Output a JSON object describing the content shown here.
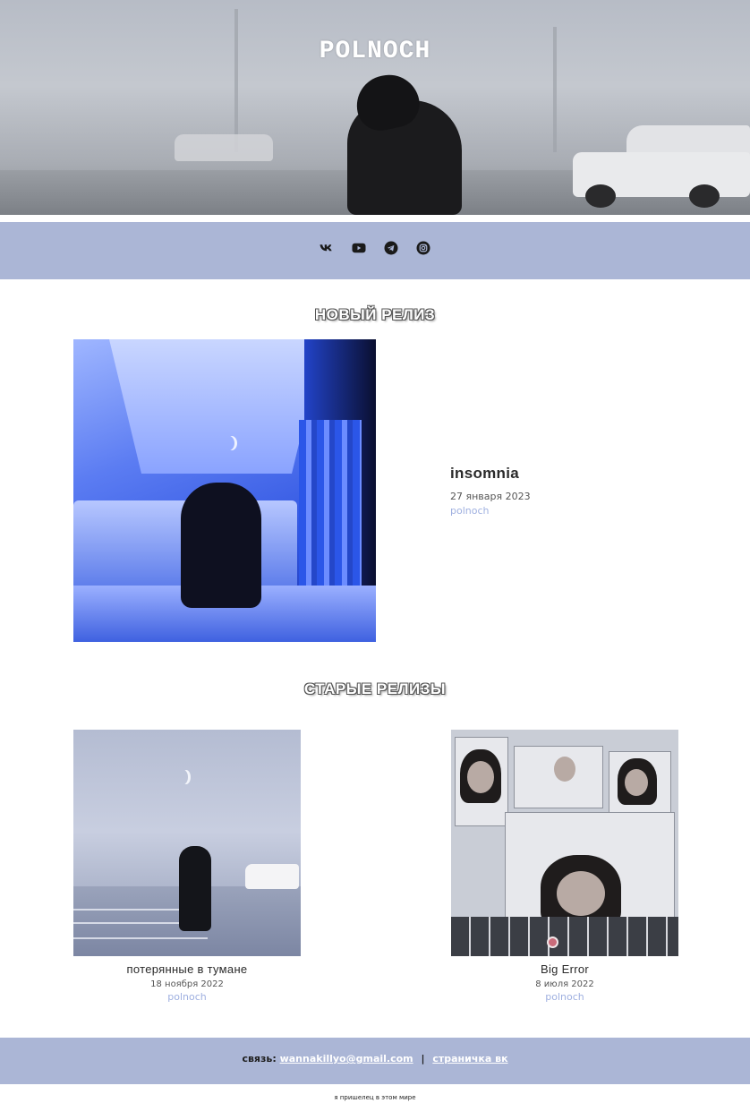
{
  "hero": {
    "title": "POLNOCH"
  },
  "social": [
    {
      "name": "vk-icon"
    },
    {
      "name": "youtube-icon"
    },
    {
      "name": "telegram-icon"
    },
    {
      "name": "instagram-icon"
    }
  ],
  "new_release": {
    "heading": "НОВЫЙ РЕЛИЗ",
    "title": "insomnia",
    "date": "27 января 2023",
    "artist": "polnoch"
  },
  "old_releases": {
    "heading": "СТАРЫЕ РЕЛИЗЫ",
    "items": [
      {
        "title": "потерянные в тумане",
        "date": "18 ноября 2022",
        "artist": "polnoch"
      },
      {
        "title": "Big Error",
        "date": "8 июля 2022",
        "artist": "polnoch"
      }
    ]
  },
  "footer": {
    "contact_label": "связь:",
    "email": "wannakillyo@gmail.com",
    "separator": "|",
    "vk_link": "страничка вк",
    "tagline": "я пришелец в этом мире"
  },
  "colors": {
    "accent_bar": "#abb6d6",
    "artist_link": "#9fb0e0"
  }
}
